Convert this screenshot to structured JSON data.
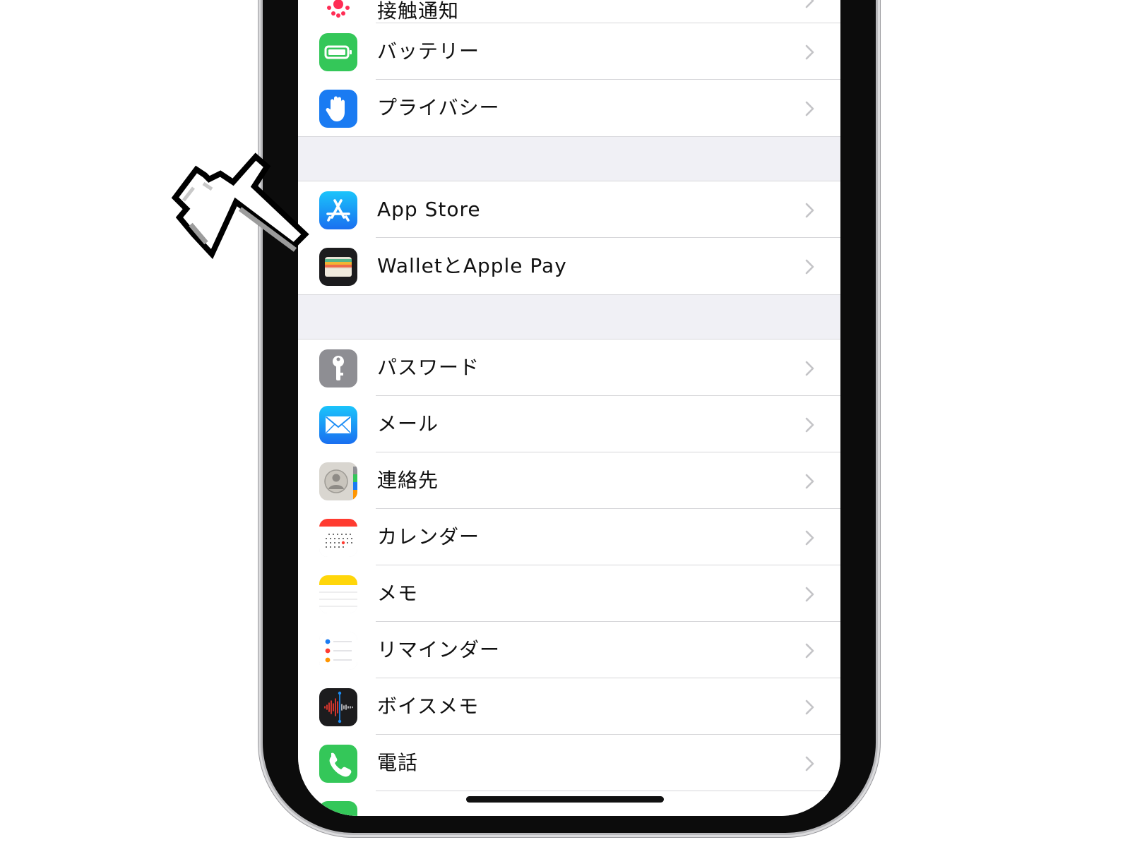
{
  "settings": {
    "top_partial": {
      "label": "接触通知",
      "icon": "exposure-notification-icon"
    },
    "group1": [
      {
        "label": "バッテリー",
        "icon": "battery-icon",
        "color": "#34c759"
      },
      {
        "label": "プライバシー",
        "icon": "privacy-hand-icon",
        "color": "#1a7bf2"
      }
    ],
    "group2": [
      {
        "label": "App Store",
        "icon": "app-store-icon",
        "color": "#1e9bf7"
      },
      {
        "label": "WalletとApple Pay",
        "icon": "wallet-icon",
        "color": "#1c1c1e"
      }
    ],
    "group3": [
      {
        "label": "パスワード",
        "icon": "key-icon",
        "color": "#8e8e93"
      },
      {
        "label": "メール",
        "icon": "mail-icon",
        "color": "#1e9bf7"
      },
      {
        "label": "連絡先",
        "icon": "contacts-icon",
        "color": "#d9d6d0"
      },
      {
        "label": "カレンダー",
        "icon": "calendar-icon",
        "color": "#ffffff"
      },
      {
        "label": "メモ",
        "icon": "notes-icon",
        "color": "#ffd60a"
      },
      {
        "label": "リマインダー",
        "icon": "reminders-icon",
        "color": "#ffffff"
      },
      {
        "label": "ボイスメモ",
        "icon": "voice-memos-icon",
        "color": "#1c1c1e"
      },
      {
        "label": "電話",
        "icon": "phone-icon",
        "color": "#34c759"
      }
    ]
  },
  "pointer": {
    "icon": "pointing-hand-cursor-icon",
    "target": "app-store-row"
  }
}
